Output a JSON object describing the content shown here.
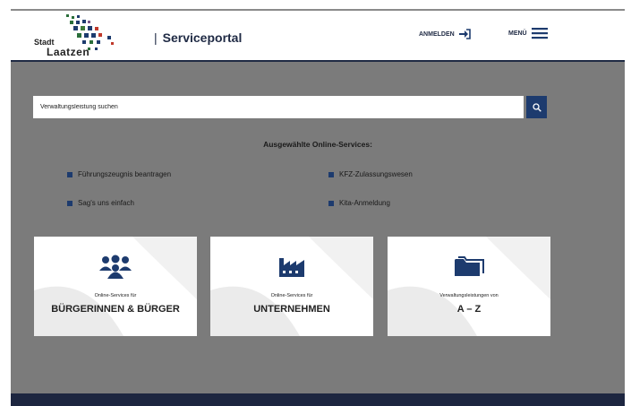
{
  "header": {
    "logo_line1": "Stadt",
    "logo_line2": "Laatzen",
    "portal_title": "Serviceportal",
    "login_label": "ANMELDEN",
    "menu_label": "MENÜ"
  },
  "search": {
    "value": "Verwaltungsleistung suchen"
  },
  "services": {
    "heading": "Ausgewählte Online-Services:",
    "links": [
      {
        "label": "Führungszeugnis beantragen"
      },
      {
        "label": "KFZ-Zulassungswesen"
      },
      {
        "label": "Sag's uns einfach"
      },
      {
        "label": "Kita-Anmeldung"
      }
    ]
  },
  "tiles": [
    {
      "small": "Online-Services für",
      "big": "BÜRGERINNEN & BÜRGER",
      "icon": "people-icon"
    },
    {
      "small": "Online-Services für",
      "big": "UNTERNEHMEN",
      "icon": "factory-icon"
    },
    {
      "small": "Verwaltungsleistungen von",
      "big": "A – Z",
      "icon": "folder-icon"
    }
  ],
  "colors": {
    "brand_navy": "#1d3b6e",
    "background_gray": "#7b7b7b",
    "footer": "#1d2640"
  }
}
